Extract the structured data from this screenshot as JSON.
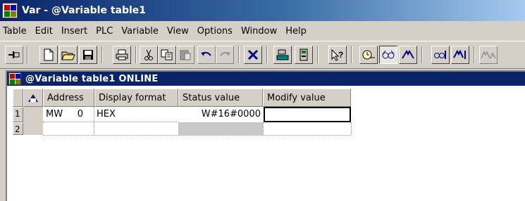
{
  "window": {
    "title": "Var - @Variable table1"
  },
  "menubar": {
    "items": [
      "Table",
      "Edit",
      "Insert",
      "PLC",
      "Variable",
      "View",
      "Options",
      "Window",
      "Help"
    ]
  },
  "toolbar": {
    "icons": [
      "pin-icon",
      "new-icon",
      "open-icon",
      "save-icon",
      "print-icon",
      "cut-icon",
      "copy-icon",
      "paste-icon",
      "undo-icon",
      "redo-icon",
      "delete-icon",
      "accessible-nodes-icon",
      "online-icon",
      "help-pointer-icon",
      "trigger-icon",
      "monitor-variable-icon",
      "modify-variable-icon",
      "update-monitor-icon",
      "activate-modify-icon",
      "force-icon"
    ]
  },
  "child_window": {
    "title": "@Variable table1  ONLINE"
  },
  "table": {
    "columns": [
      "Address",
      "Display format",
      "Status value",
      "Modify value"
    ],
    "rows": [
      {
        "num": "1",
        "address": "MW     0",
        "format": "HEX",
        "status": "W#16#0000",
        "modify": ""
      },
      {
        "num": "2",
        "address": "",
        "format": "",
        "status": "",
        "modify": ""
      }
    ]
  },
  "colors": {
    "title_active": "#0a246a",
    "chrome": "#d4d0c8",
    "status_column": "#c8c8c8"
  }
}
